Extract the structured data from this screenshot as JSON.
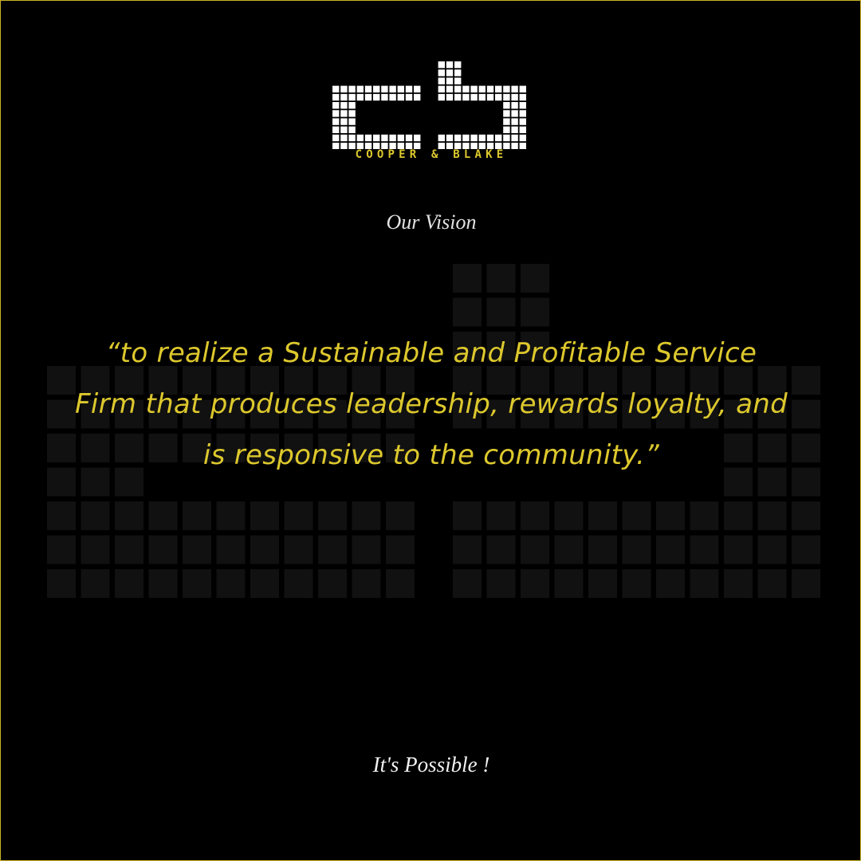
{
  "brand": {
    "monogram": "cb",
    "wordmark": "COOPER & BLAKE"
  },
  "heading": "Our Vision",
  "quote": "“to realize a Sustainable and Profitable Service Firm that produces leadership, rewards loyalty, and is responsive to the community.”",
  "tagline": "It's Possible !",
  "colors": {
    "background": "#000000",
    "accent": "#ddc82d",
    "text": "#e2e2e2",
    "watermark": "#111111"
  }
}
